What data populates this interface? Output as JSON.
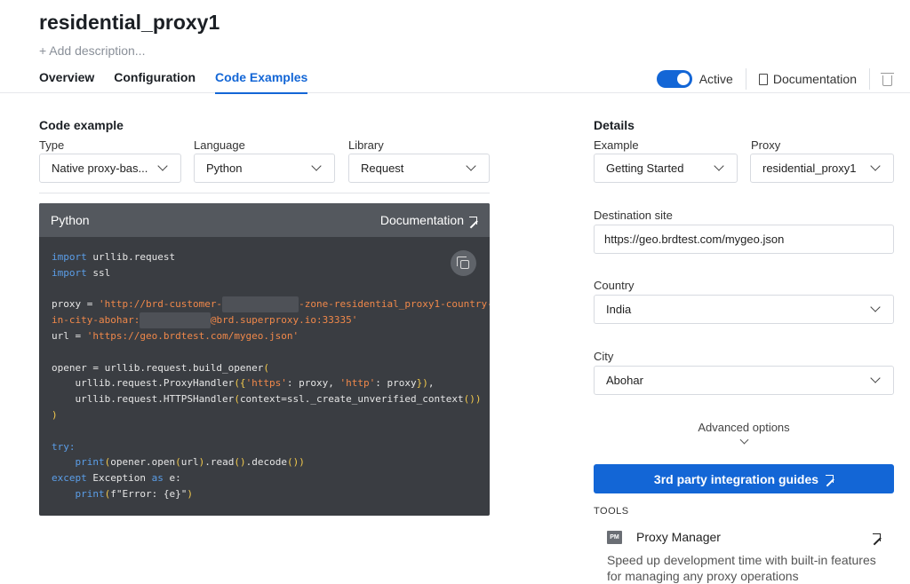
{
  "header": {
    "title": "residential_proxy1",
    "add_description": "+ Add description...",
    "tabs": [
      {
        "label": "Overview"
      },
      {
        "label": "Configuration"
      },
      {
        "label": "Code Examples"
      }
    ],
    "active_label": "Active",
    "documentation_label": "Documentation"
  },
  "code_example": {
    "section_title": "Code example",
    "type_label": "Type",
    "type_value": "Native proxy-bas...",
    "language_label": "Language",
    "language_value": "Python",
    "library_label": "Library",
    "library_value": "Request",
    "card_title": "Python",
    "card_doc_label": "Documentation",
    "code": {
      "l1_kw": "import",
      "l1_rest": " urllib.request",
      "l2_kw": "import",
      "l2_rest": " ssl",
      "proxy_prefix": "proxy = ",
      "proxy_s1": "'http://brd-customer-",
      "proxy_red1": "hl_xxxxxxxxxx",
      "proxy_s2": "-zone-residential_proxy1-country-",
      "proxy_s3": "in-city-abohar:",
      "proxy_red2": "xxxxxxxxxxxx",
      "proxy_s4": "@brd.superproxy.io:33335'",
      "url_prefix": "url = ",
      "url_str": "'https://geo.brdtest.com/mygeo.json'",
      "opener": "opener = urllib.request.build_opener",
      "ph_a": "    urllib.request.ProxyHandler",
      "ph_s1": "'https'",
      "ph_mid": ": proxy, ",
      "ph_s2": "'http'",
      "ph_end": ": proxy",
      "hh": "    urllib.request.HTTPSHandler",
      "hh_args": "context=ssl._create_unverified_context",
      "try_kw": "try:",
      "print1_kw": "print",
      "print1_a": "opener.open",
      "print1_b": "url",
      "print1_c": ".read",
      "print1_d": ".decode",
      "except_kw": "except",
      "except_mid": " Exception ",
      "as_kw": "as",
      "except_end": " e:",
      "print2_kw": "print",
      "print2_f": "f\"Error: {e}\""
    }
  },
  "details": {
    "section_title": "Details",
    "example_label": "Example",
    "example_value": "Getting Started",
    "proxy_label": "Proxy",
    "proxy_value": "residential_proxy1",
    "destination_label": "Destination site",
    "destination_value": "https://geo.brdtest.com/mygeo.json",
    "country_label": "Country",
    "country_value": "India",
    "city_label": "City",
    "city_value": "Abohar",
    "advanced_options": "Advanced options",
    "cta_label": "3rd party integration guides",
    "tools_heading": "TOOLS",
    "tool_icon_text": "PM",
    "tool_name": "Proxy Manager",
    "tool_desc": "Speed up development time with built-in features for managing any proxy operations"
  },
  "colors": {
    "accent": "#1366d6",
    "code_bg": "#3a3d42"
  },
  "icons": [
    "document-icon",
    "trash-icon",
    "copy-icon",
    "external-link-icon",
    "chevron-down-icon",
    "proxy-manager-icon"
  ]
}
